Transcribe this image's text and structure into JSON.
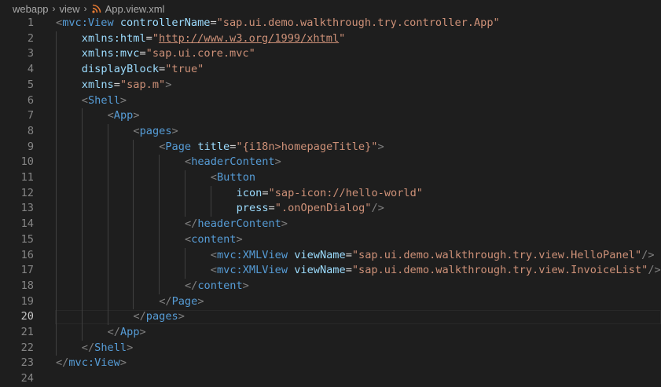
{
  "breadcrumb": {
    "items": [
      "webapp",
      "view",
      "App.view.xml"
    ],
    "file_icon": "rss-icon"
  },
  "editor": {
    "active_line": 20,
    "extra_line_number": "24",
    "colors": {
      "background": "#1e1e1e",
      "tag": "#569cd6",
      "attribute": "#9cdcfe",
      "string": "#ce9178",
      "punctuation": "#808080",
      "line_number": "#858585"
    },
    "lines": [
      {
        "n": "1",
        "indent": 0,
        "tokens": [
          [
            "punc",
            "<"
          ],
          [
            "tag",
            "mvc:View"
          ],
          [
            "eq",
            " "
          ],
          [
            "attr",
            "controllerName"
          ],
          [
            "eq",
            "="
          ],
          [
            "str",
            "\"sap.ui.demo.walkthrough.try.controller.App\""
          ]
        ]
      },
      {
        "n": "2",
        "indent": 1,
        "tokens": [
          [
            "attr",
            "xmlns:html"
          ],
          [
            "eq",
            "="
          ],
          [
            "str",
            "\""
          ],
          [
            "link",
            "http://www.w3.org/1999/xhtml"
          ],
          [
            "str",
            "\""
          ]
        ]
      },
      {
        "n": "3",
        "indent": 1,
        "tokens": [
          [
            "attr",
            "xmlns:mvc"
          ],
          [
            "eq",
            "="
          ],
          [
            "str",
            "\"sap.ui.core.mvc\""
          ]
        ]
      },
      {
        "n": "4",
        "indent": 1,
        "tokens": [
          [
            "attr",
            "displayBlock"
          ],
          [
            "eq",
            "="
          ],
          [
            "str",
            "\"true\""
          ]
        ]
      },
      {
        "n": "5",
        "indent": 1,
        "tokens": [
          [
            "attr",
            "xmlns"
          ],
          [
            "eq",
            "="
          ],
          [
            "str",
            "\"sap.m\""
          ],
          [
            "punc",
            ">"
          ]
        ]
      },
      {
        "n": "6",
        "indent": 1,
        "tokens": [
          [
            "punc",
            "<"
          ],
          [
            "tag",
            "Shell"
          ],
          [
            "punc",
            ">"
          ]
        ]
      },
      {
        "n": "7",
        "indent": 2,
        "tokens": [
          [
            "punc",
            "<"
          ],
          [
            "tag",
            "App"
          ],
          [
            "punc",
            ">"
          ]
        ]
      },
      {
        "n": "8",
        "indent": 3,
        "tokens": [
          [
            "punc",
            "<"
          ],
          [
            "tag",
            "pages"
          ],
          [
            "punc",
            ">"
          ]
        ]
      },
      {
        "n": "9",
        "indent": 4,
        "tokens": [
          [
            "punc",
            "<"
          ],
          [
            "tag",
            "Page"
          ],
          [
            "eq",
            " "
          ],
          [
            "attr",
            "title"
          ],
          [
            "eq",
            "="
          ],
          [
            "str",
            "\"{i18n>homepageTitle}\""
          ],
          [
            "punc",
            ">"
          ]
        ]
      },
      {
        "n": "10",
        "indent": 5,
        "tokens": [
          [
            "punc",
            "<"
          ],
          [
            "tag",
            "headerContent"
          ],
          [
            "punc",
            ">"
          ]
        ]
      },
      {
        "n": "11",
        "indent": 6,
        "tokens": [
          [
            "punc",
            "<"
          ],
          [
            "tag",
            "Button"
          ]
        ]
      },
      {
        "n": "12",
        "indent": 7,
        "tokens": [
          [
            "attr",
            "icon"
          ],
          [
            "eq",
            "="
          ],
          [
            "str",
            "\"sap-icon://hello-world\""
          ]
        ]
      },
      {
        "n": "13",
        "indent": 7,
        "tokens": [
          [
            "attr",
            "press"
          ],
          [
            "eq",
            "="
          ],
          [
            "str",
            "\".onOpenDialog\""
          ],
          [
            "punc",
            "/>"
          ]
        ]
      },
      {
        "n": "14",
        "indent": 5,
        "tokens": [
          [
            "punc",
            "</"
          ],
          [
            "tag",
            "headerContent"
          ],
          [
            "punc",
            ">"
          ]
        ]
      },
      {
        "n": "15",
        "indent": 5,
        "tokens": [
          [
            "punc",
            "<"
          ],
          [
            "tag",
            "content"
          ],
          [
            "punc",
            ">"
          ]
        ]
      },
      {
        "n": "16",
        "indent": 6,
        "tokens": [
          [
            "punc",
            "<"
          ],
          [
            "tag",
            "mvc:XMLView"
          ],
          [
            "eq",
            " "
          ],
          [
            "attr",
            "viewName"
          ],
          [
            "eq",
            "="
          ],
          [
            "str",
            "\"sap.ui.demo.walkthrough.try.view.HelloPanel\""
          ],
          [
            "punc",
            "/>"
          ]
        ]
      },
      {
        "n": "17",
        "indent": 6,
        "tokens": [
          [
            "punc",
            "<"
          ],
          [
            "tag",
            "mvc:XMLView"
          ],
          [
            "eq",
            " "
          ],
          [
            "attr",
            "viewName"
          ],
          [
            "eq",
            "="
          ],
          [
            "str",
            "\"sap.ui.demo.walkthrough.try.view.InvoiceList\""
          ],
          [
            "punc",
            "/>"
          ]
        ]
      },
      {
        "n": "18",
        "indent": 5,
        "tokens": [
          [
            "punc",
            "</"
          ],
          [
            "tag",
            "content"
          ],
          [
            "punc",
            ">"
          ]
        ]
      },
      {
        "n": "19",
        "indent": 4,
        "tokens": [
          [
            "punc",
            "</"
          ],
          [
            "tag",
            "Page"
          ],
          [
            "punc",
            ">"
          ]
        ]
      },
      {
        "n": "20",
        "indent": 3,
        "tokens": [
          [
            "punc",
            "</"
          ],
          [
            "tag",
            "pages"
          ],
          [
            "punc",
            ">"
          ]
        ]
      },
      {
        "n": "21",
        "indent": 2,
        "tokens": [
          [
            "punc",
            "</"
          ],
          [
            "tag",
            "App"
          ],
          [
            "punc",
            ">"
          ]
        ]
      },
      {
        "n": "22",
        "indent": 1,
        "tokens": [
          [
            "punc",
            "</"
          ],
          [
            "tag",
            "Shell"
          ],
          [
            "punc",
            ">"
          ]
        ]
      },
      {
        "n": "23",
        "indent": 0,
        "tokens": [
          [
            "punc",
            "</"
          ],
          [
            "tag",
            "mvc:View"
          ],
          [
            "punc",
            ">"
          ]
        ]
      }
    ]
  }
}
